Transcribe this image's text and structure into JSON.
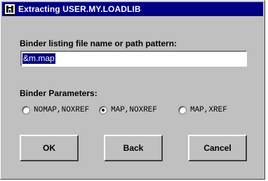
{
  "window": {
    "title": "Extracting USER.MY.LOADLIB",
    "icon": "app-window-icon"
  },
  "form": {
    "listing_label": "Binder listing file name or path pattern:",
    "listing_value": "&m.map",
    "params_label": "Binder Parameters:",
    "options": [
      {
        "label": "NOMAP,NOXREF",
        "checked": false
      },
      {
        "label": "MAP,NOXREF",
        "checked": true
      },
      {
        "label": "MAP,XREF",
        "checked": false
      }
    ]
  },
  "buttons": {
    "ok": "OK",
    "back": "Back",
    "cancel": "Cancel"
  },
  "colors": {
    "titlebar": "#000080",
    "dialog": "#c0c0c0",
    "selection": "#000080"
  }
}
